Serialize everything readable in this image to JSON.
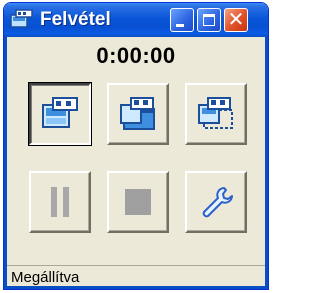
{
  "window": {
    "title": "Felvétel",
    "app_icon": "recorder-app-icon"
  },
  "caption_buttons": {
    "minimize": "minimize-icon",
    "maximize": "maximize-icon",
    "close": "close-icon"
  },
  "timer": {
    "value": "0:00:00"
  },
  "toolbar": {
    "buttons": [
      {
        "icon": "record-fullscreen-icon",
        "state": "pressed"
      },
      {
        "icon": "record-window-icon",
        "state": "normal"
      },
      {
        "icon": "record-region-icon",
        "state": "normal"
      },
      {
        "icon": "pause-icon",
        "state": "disabled"
      },
      {
        "icon": "stop-icon",
        "state": "disabled"
      },
      {
        "icon": "settings-wrench-icon",
        "state": "normal"
      }
    ]
  },
  "status": {
    "text": "Megállítva"
  },
  "colors": {
    "titlebar": "#0a56d8",
    "close_button": "#e0512a",
    "face": "#ece9d8",
    "disabled_glyph": "#a8a8a8"
  }
}
